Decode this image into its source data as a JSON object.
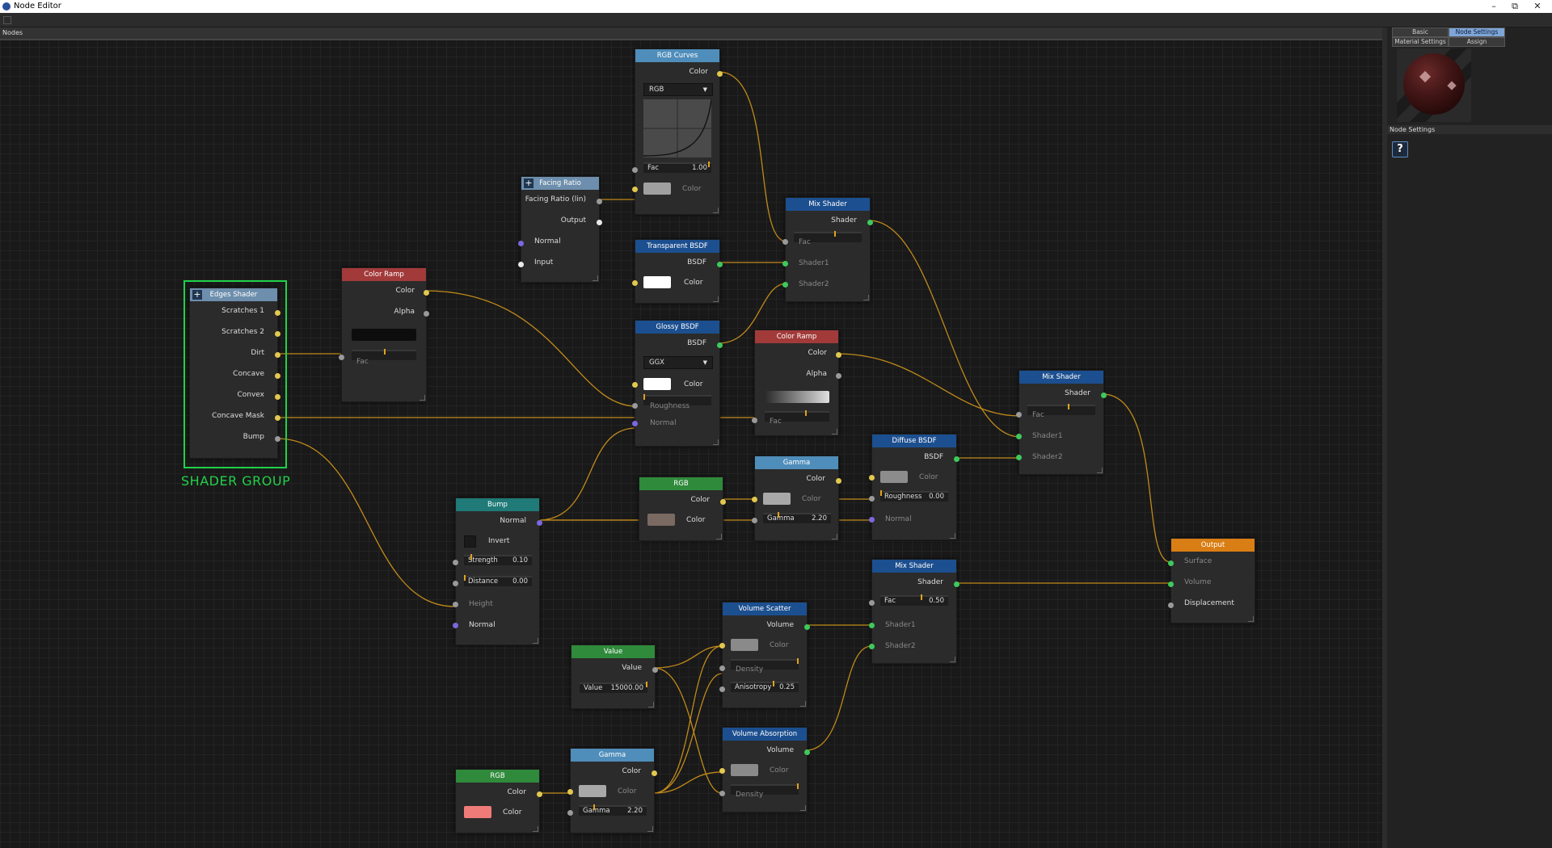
{
  "window": {
    "title": "Node Editor",
    "controls": [
      "–",
      "⧉",
      "✕"
    ]
  },
  "canvas": {
    "header": "Nodes"
  },
  "group": {
    "label": "SHADER GROUP"
  },
  "nodes": {
    "edges_shader": {
      "title": "Edges Shader",
      "outputs": [
        "Scratches 1",
        "Scratches 2",
        "Dirt",
        "Concave",
        "Convex",
        "Concave Mask",
        "Bump"
      ]
    },
    "color_ramp_1": {
      "title": "Color Ramp",
      "outputs": [
        "Color",
        "Alpha"
      ],
      "fac": "Fac"
    },
    "facing_ratio": {
      "title": "Facing Ratio",
      "rows": [
        "Facing Ratio (lin)",
        "Output",
        "Normal",
        "Input"
      ]
    },
    "rgb_curves": {
      "title": "RGB Curves",
      "output": "Color",
      "mode": "RGB",
      "fac_label": "Fac",
      "fac_value": "1.00",
      "color_label": "Color"
    },
    "transparent_bsdf": {
      "title": "Transparent BSDF",
      "output": "BSDF",
      "color_label": "Color"
    },
    "glossy_bsdf": {
      "title": "Glossy BSDF",
      "output": "BSDF",
      "dist": "GGX",
      "color_label": "Color",
      "roughness": "Roughness",
      "normal": "Normal"
    },
    "mix_shader_1": {
      "title": "Mix Shader",
      "output": "Shader",
      "fac": "Fac",
      "shader1": "Shader1",
      "shader2": "Shader2"
    },
    "color_ramp_2": {
      "title": "Color Ramp",
      "outputs": [
        "Color",
        "Alpha"
      ],
      "fac": "Fac"
    },
    "mix_shader_2": {
      "title": "Mix Shader",
      "output": "Shader",
      "fac": "Fac",
      "shader1": "Shader1",
      "shader2": "Shader2"
    },
    "diffuse_bsdf": {
      "title": "Diffuse BSDF",
      "output": "BSDF",
      "color_label": "Color",
      "roughness_label": "Roughness",
      "roughness_value": "0.00",
      "normal": "Normal"
    },
    "gamma_1": {
      "title": "Gamma",
      "output": "Color",
      "color_label": "Color",
      "gamma_label": "Gamma",
      "gamma_value": "2.20"
    },
    "rgb_1": {
      "title": "RGB",
      "output": "Color",
      "color_label": "Color"
    },
    "bump": {
      "title": "Bump",
      "output": "Normal",
      "invert": "Invert",
      "strength_label": "Strength",
      "strength_value": "0.10",
      "distance_label": "Distance",
      "distance_value": "0.00",
      "height": "Height",
      "normal": "Normal"
    },
    "output": {
      "title": "Output",
      "inputs": [
        "Surface",
        "Volume",
        "Displacement"
      ]
    },
    "mix_shader_3": {
      "title": "Mix Shader",
      "output": "Shader",
      "fac_label": "Fac",
      "fac_value": "0.50",
      "shader1": "Shader1",
      "shader2": "Shader2"
    },
    "volume_scatter": {
      "title": "Volume Scatter",
      "output": "Volume",
      "color_label": "Color",
      "density": "Density",
      "aniso_label": "Anisotropy",
      "aniso_value": "0.25"
    },
    "value": {
      "title": "Value",
      "output": "Value",
      "value_label": "Value",
      "value_value": "15000.00"
    },
    "volume_absorption": {
      "title": "Volume Absorption",
      "output": "Volume",
      "color_label": "Color",
      "density": "Density"
    },
    "gamma_2": {
      "title": "Gamma",
      "output": "Color",
      "color_label": "Color",
      "gamma_label": "Gamma",
      "gamma_value": "2.20"
    },
    "rgb_2": {
      "title": "RGB",
      "output": "Color",
      "color_label": "Color"
    }
  },
  "sidebar": {
    "tabs": [
      {
        "label": "Basic",
        "active": false
      },
      {
        "label": "Node Settings",
        "active": true
      },
      {
        "label": "Material Settings",
        "active": false
      },
      {
        "label": "Assign",
        "active": false
      }
    ],
    "section": "Node Settings",
    "help_label": "?"
  },
  "colors": {
    "header_red": "#a23a3a",
    "header_blue": "#1c4f8f",
    "header_lightblue": "#4f8dba",
    "header_green": "#2f8a3b",
    "header_teal": "#1f7a78",
    "header_orange": "#d97e15",
    "wire": "#c08a1a",
    "group_frame": "#1ed24a"
  }
}
